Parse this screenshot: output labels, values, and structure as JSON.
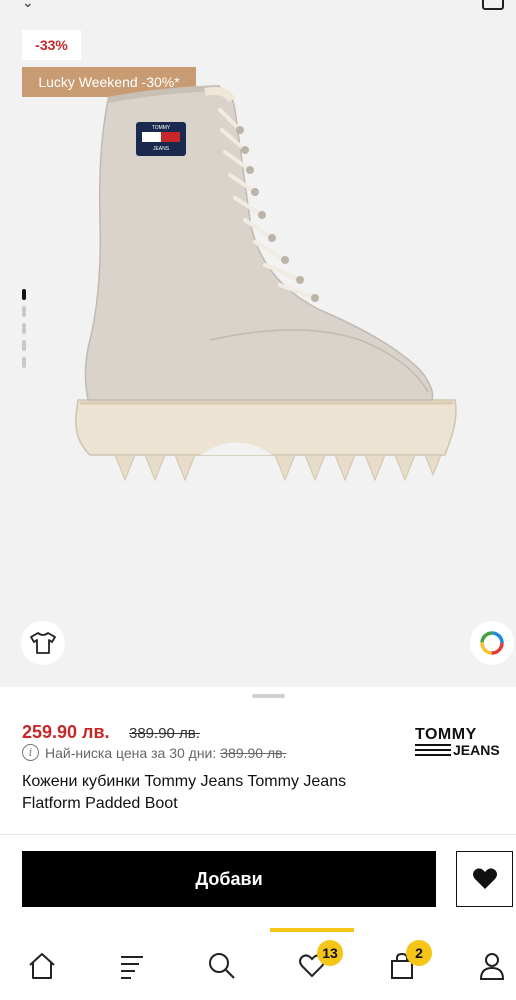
{
  "gallery": {
    "discount_badge": "-33%",
    "promo_badge": "Lucky Weekend -30%*",
    "image_count": 5,
    "active_image": 1,
    "boot_patch_text_top": "TOMMY",
    "boot_patch_text_bottom": "JEANS"
  },
  "product": {
    "price_current": "259.90 лв.",
    "price_old": "389.90 лв.",
    "lowest_label": "Най-ниска цена за 30 дни:",
    "lowest_price": "389.90 лв.",
    "name": "Кожени кубинки Tommy Jeans Tommy Jeans Flatform Padded Boot",
    "brand_line1": "TOMMY",
    "brand_line2": "JEANS"
  },
  "actions": {
    "add_label": "Добави"
  },
  "nav": {
    "favorites_count": "13",
    "cart_count": "2"
  },
  "colors": {
    "accent_yellow": "#f5c518",
    "discount_red": "#c62828",
    "promo_tan": "#c89b73"
  }
}
